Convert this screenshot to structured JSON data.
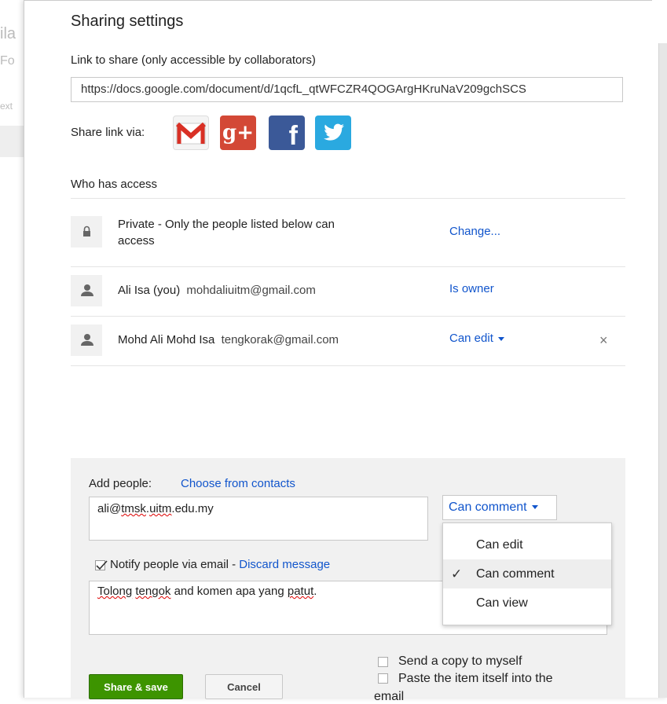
{
  "background": {
    "fragments": [
      "ila",
      "Fo",
      "ext"
    ]
  },
  "dialog": {
    "title": "Sharing settings",
    "link_label": "Link to share (only accessible by collaborators)",
    "link_url": "https://docs.google.com/document/d/1qcfL_qtWFCZR4QOGArgHKruNaV209gchSCS",
    "share_via_label": "Share link via:",
    "share_icons": [
      "gmail-icon",
      "google-plus-icon",
      "facebook-icon",
      "twitter-icon"
    ],
    "gplus_glyph": "g+",
    "fb_glyph": "f",
    "who_has_access_label": "Who has access",
    "access_rows": [
      {
        "icon": "lock-icon",
        "line1": "Private - Only the people listed below can",
        "line2": "access",
        "action": "Change..."
      },
      {
        "icon": "person-icon",
        "name": "Ali Isa (you)",
        "email": "mohdaliuitm@gmail.com",
        "action": "Is owner"
      },
      {
        "icon": "person-icon",
        "name": "Mohd Ali Mohd Isa",
        "email": "tengkorak@gmail.com",
        "action": "Can edit",
        "remove": "×"
      }
    ],
    "add_people": {
      "label": "Add people:",
      "contacts_link": "Choose from contacts",
      "input_prefix": "ali@",
      "input_misspelled_1": "tmsk",
      "input_dot": ".",
      "input_misspelled_2": "uitm",
      "input_suffix": ".edu.my",
      "permission_selected": "Can comment",
      "menu_items": [
        "Can edit",
        "Can comment",
        "Can view"
      ],
      "menu_selected_index": 1,
      "check_glyph": "✓",
      "notify_checked": true,
      "notify_label": "Notify people via email - ",
      "discard_link": "Discard message",
      "message_word1": "Tolong",
      "message_word2": "tengok",
      "message_middle": " and komen apa yang ",
      "message_word3": "patut",
      "message_end": ".",
      "send_copy_label": "Send a copy to myself",
      "paste_item_label_1": "Paste the item itself into the",
      "paste_item_label_2": "email",
      "share_button": "Share & save",
      "cancel_button": "Cancel"
    }
  },
  "colors": {
    "link": "#1155cc",
    "share_button": "#3d9400",
    "gplus": "#d34836",
    "facebook": "#3b5998",
    "twitter": "#2aa9e0"
  }
}
